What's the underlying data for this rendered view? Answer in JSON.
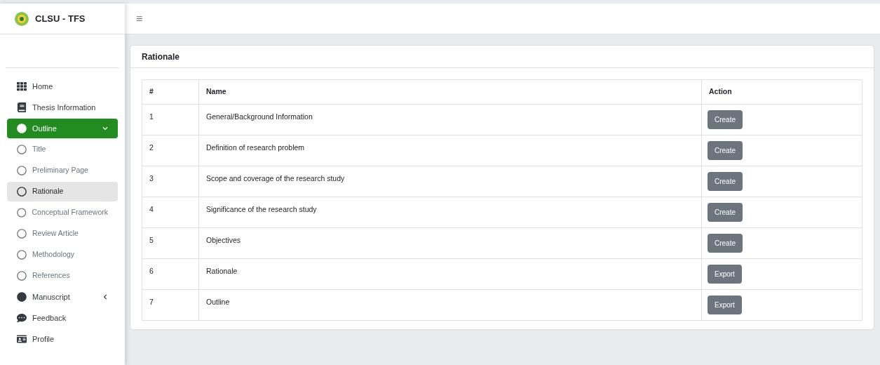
{
  "brand": {
    "name": "CLSU - TFS"
  },
  "toolbar": {
    "menu_icon": "≡"
  },
  "sidebar": {
    "items": [
      {
        "label": "Home",
        "kind": "grid",
        "selected": false
      },
      {
        "label": "Thesis Information",
        "kind": "book",
        "selected": false
      },
      {
        "label": "Outline",
        "kind": "dot",
        "selected": true,
        "expanded": true,
        "children": [
          {
            "label": "Title",
            "selected": false
          },
          {
            "label": "Preliminary Page",
            "selected": false
          },
          {
            "label": "Rationale",
            "selected": true
          },
          {
            "label": "Conceptual Framework",
            "selected": false
          },
          {
            "label": "Review Article",
            "selected": false
          },
          {
            "label": "Methodology",
            "selected": false
          },
          {
            "label": "References",
            "selected": false
          }
        ]
      },
      {
        "label": "Manuscript",
        "kind": "dot",
        "selected": false,
        "expanded": false
      },
      {
        "label": "Feedback",
        "kind": "comment",
        "selected": false
      },
      {
        "label": "Profile",
        "kind": "card",
        "selected": false
      }
    ]
  },
  "card": {
    "title": "Rationale",
    "table": {
      "columns": [
        "#",
        "Name",
        "Action"
      ],
      "rows": [
        {
          "number": "1",
          "name": "General/Background Information",
          "action": "Create"
        },
        {
          "number": "2",
          "name": "Definition of research problem",
          "action": "Create"
        },
        {
          "number": "3",
          "name": "Scope and coverage of the research study",
          "action": "Create"
        },
        {
          "number": "4",
          "name": "Significance of the research study",
          "action": "Create"
        },
        {
          "number": "5",
          "name": "Objectives",
          "action": "Create"
        },
        {
          "number": "6",
          "name": "Rationale",
          "action": "Export"
        },
        {
          "number": "7",
          "name": "Outline",
          "action": "Export"
        }
      ]
    }
  }
}
